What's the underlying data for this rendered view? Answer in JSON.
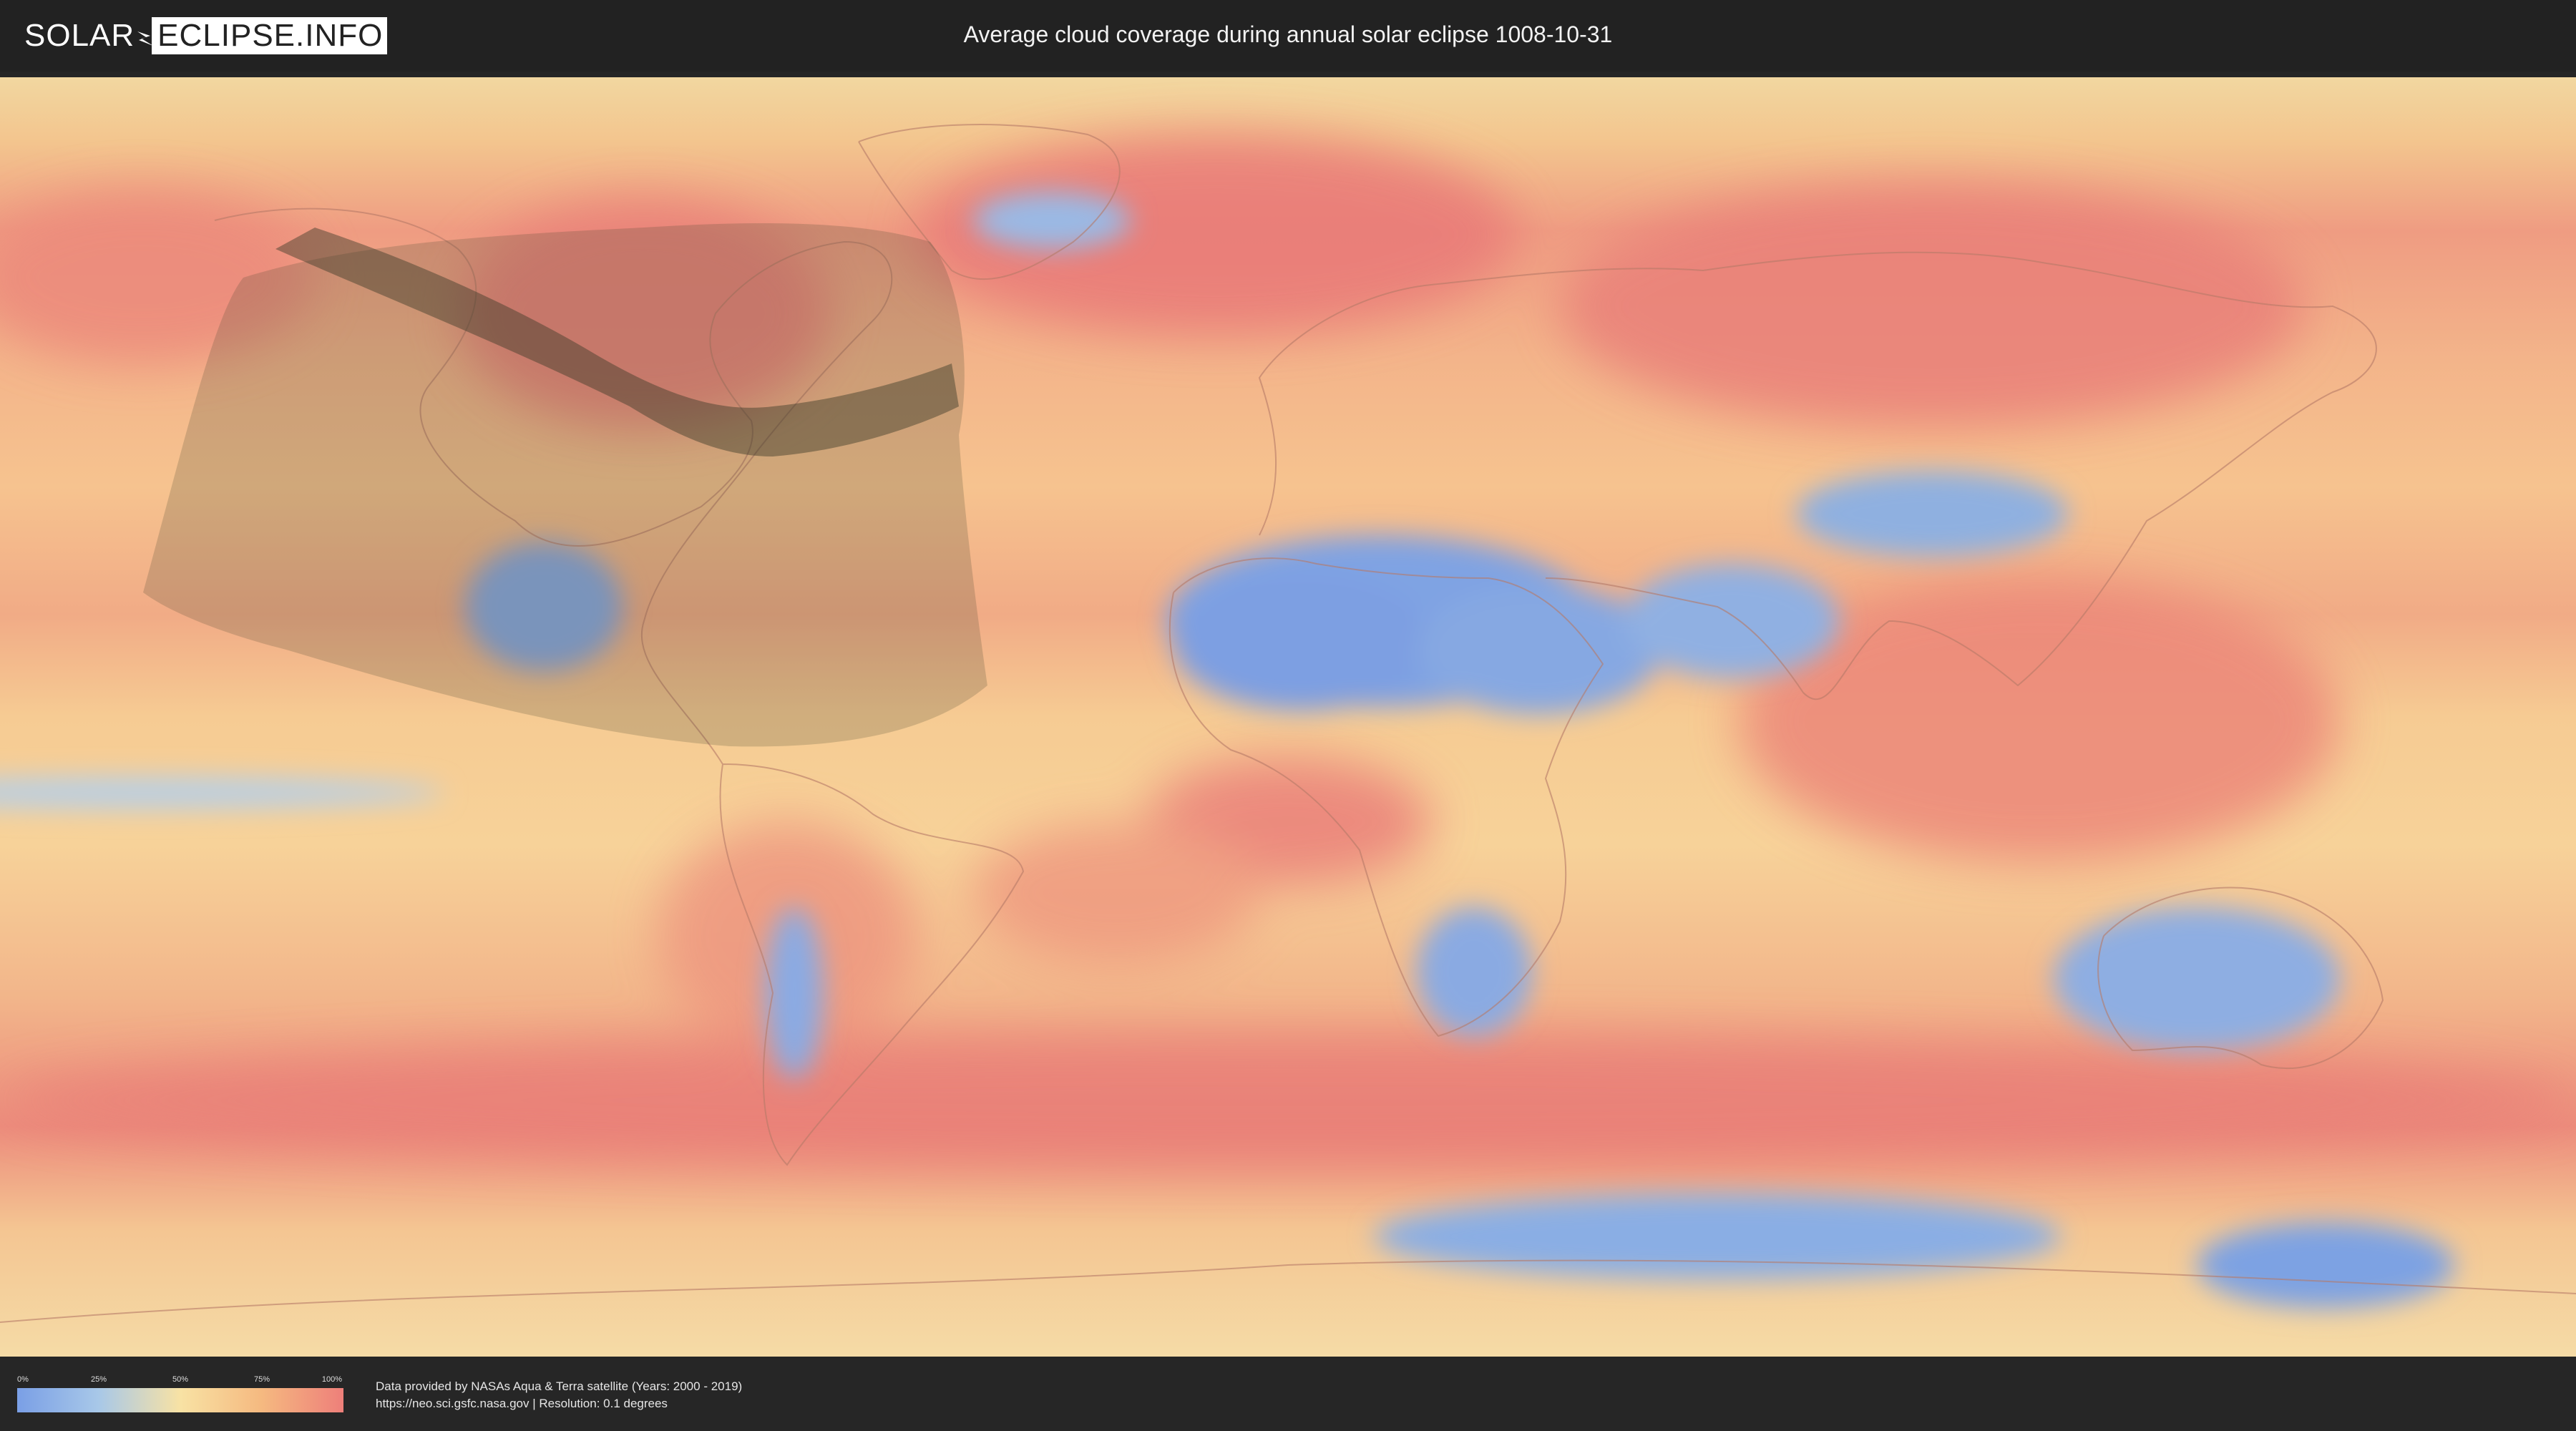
{
  "header": {
    "logo_left": "SOLAR",
    "logo_right": "ECLIPSE.INFO",
    "title": "Average cloud coverage during annual solar eclipse 1008-10-31"
  },
  "map": {
    "description_layers": [
      "cloud-coverage-raster",
      "eclipse-penumbra-region",
      "annular-path-band"
    ],
    "colors": {
      "low_cloud": "#7a9fe6",
      "light_cloud": "#a8c8e8",
      "mid_cloud": "#f8e2a4",
      "high_cloud": "#f5b980",
      "full_cloud": "#ee7f7a",
      "eclipse_shadow": "#4a4a30"
    }
  },
  "legend": {
    "ticks": [
      "0%",
      "25%",
      "50%",
      "75%",
      "100%"
    ],
    "tick_values": [
      0,
      25,
      50,
      75,
      100
    ]
  },
  "footer": {
    "credit_line1": "Data provided by NASAs Aqua & Terra satellite (Years: 2000 - 2019)",
    "credit_line2": "https://neo.sci.gsfc.nasa.gov | Resolution: 0.1 degrees"
  }
}
